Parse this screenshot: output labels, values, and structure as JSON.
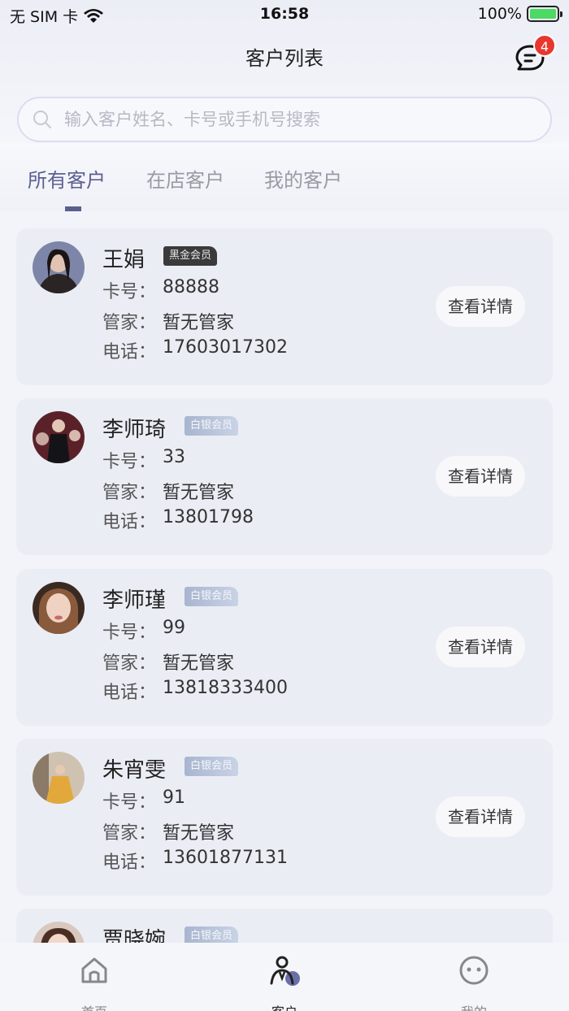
{
  "status_bar": {
    "carrier": "无 SIM 卡",
    "time": "16:58",
    "battery": "100%"
  },
  "header": {
    "title": "客户列表",
    "message_badge": "4"
  },
  "search": {
    "placeholder": "输入客户姓名、卡号或手机号搜索"
  },
  "tabs": [
    {
      "label": "所有客户",
      "active": true
    },
    {
      "label": "在店客户",
      "active": false
    },
    {
      "label": "我的客户",
      "active": false
    }
  ],
  "labels": {
    "card": "卡号：",
    "manager": "管家：",
    "phone": "电话：",
    "detail": "查看详情"
  },
  "customers": [
    {
      "name": "王娟",
      "tier": "黑金会员",
      "card": "88888",
      "manager": "暂无管家",
      "phone": "17603017302"
    },
    {
      "name": "李师琦",
      "tier": "白银会员",
      "card": "33",
      "manager": "暂无管家",
      "phone": "13801798"
    },
    {
      "name": "李师瑾",
      "tier": "白银会员",
      "card": "99",
      "manager": "暂无管家",
      "phone": "13818333400"
    },
    {
      "name": "朱宵雯",
      "tier": "白银会员",
      "card": "91",
      "manager": "暂无管家",
      "phone": "13601877131"
    },
    {
      "name": "贾晓婉",
      "tier": "白银会员"
    }
  ],
  "tabbar": [
    {
      "label": "首页",
      "icon": "home-icon",
      "active": false
    },
    {
      "label": "客户",
      "icon": "customer-icon",
      "active": true
    },
    {
      "label": "我的",
      "icon": "smiley-icon",
      "active": false
    }
  ],
  "colors": {
    "accent": "#5b5f8f",
    "badge_red": "#e8372f",
    "card_bg": "#ebedf5"
  }
}
